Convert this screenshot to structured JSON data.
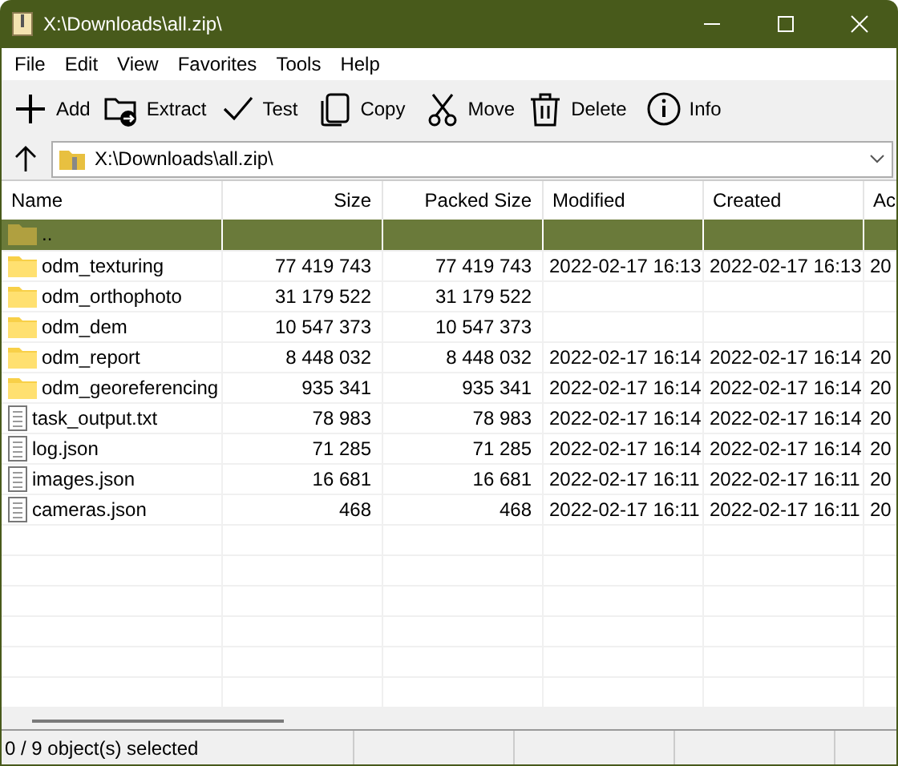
{
  "window": {
    "title": "X:\\Downloads\\all.zip\\"
  },
  "menu": [
    "File",
    "Edit",
    "View",
    "Favorites",
    "Tools",
    "Help"
  ],
  "toolbar": [
    {
      "kind": "add",
      "label": "Add"
    },
    {
      "kind": "extract",
      "label": "Extract"
    },
    {
      "kind": "test",
      "label": "Test"
    },
    {
      "kind": "copy",
      "label": "Copy"
    },
    {
      "kind": "move",
      "label": "Move"
    },
    {
      "kind": "delete",
      "label": "Delete"
    },
    {
      "kind": "info",
      "label": "Info"
    }
  ],
  "address": {
    "value": "X:\\Downloads\\all.zip\\"
  },
  "table": {
    "columns": [
      "Name",
      "Size",
      "Packed Size",
      "Modified",
      "Created",
      "Ac"
    ],
    "rows": [
      {
        "kind": "parent",
        "selected": true,
        "cells": [
          "..",
          "",
          "",
          "",
          "",
          ""
        ]
      },
      {
        "kind": "folder",
        "selected": false,
        "cells": [
          "odm_texturing",
          "77 419 743",
          "77 419 743",
          "2022-02-17 16:13",
          "2022-02-17 16:13",
          "20"
        ]
      },
      {
        "kind": "folder",
        "selected": false,
        "cells": [
          "odm_orthophoto",
          "31 179 522",
          "31 179 522",
          "",
          "",
          ""
        ]
      },
      {
        "kind": "folder",
        "selected": false,
        "cells": [
          "odm_dem",
          "10 547 373",
          "10 547 373",
          "",
          "",
          ""
        ]
      },
      {
        "kind": "folder",
        "selected": false,
        "cells": [
          "odm_report",
          "8 448 032",
          "8 448 032",
          "2022-02-17 16:14",
          "2022-02-17 16:14",
          "20"
        ]
      },
      {
        "kind": "folder",
        "selected": false,
        "cells": [
          "odm_georeferencing",
          "935 341",
          "935 341",
          "2022-02-17 16:14",
          "2022-02-17 16:14",
          "20"
        ]
      },
      {
        "kind": "file",
        "selected": false,
        "cells": [
          "task_output.txt",
          "78 983",
          "78 983",
          "2022-02-17 16:14",
          "2022-02-17 16:14",
          "20"
        ]
      },
      {
        "kind": "file",
        "selected": false,
        "cells": [
          "log.json",
          "71 285",
          "71 285",
          "2022-02-17 16:14",
          "2022-02-17 16:14",
          "20"
        ]
      },
      {
        "kind": "file",
        "selected": false,
        "cells": [
          "images.json",
          "16 681",
          "16 681",
          "2022-02-17 16:11",
          "2022-02-17 16:11",
          "20"
        ]
      },
      {
        "kind": "file",
        "selected": false,
        "cells": [
          "cameras.json",
          "468",
          "468",
          "2022-02-17 16:11",
          "2022-02-17 16:11",
          "20"
        ]
      }
    ]
  },
  "status_bar": "0 / 9 object(s) selected"
}
